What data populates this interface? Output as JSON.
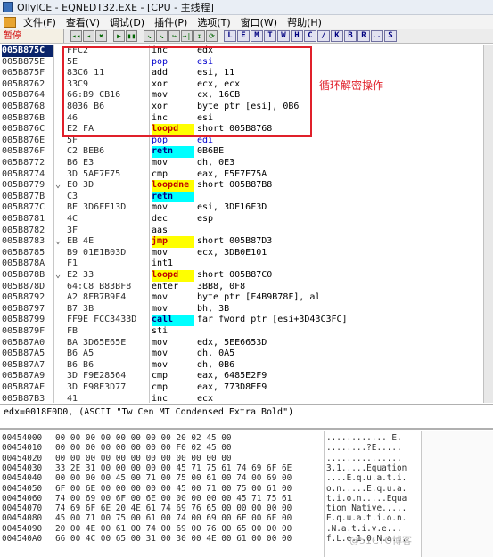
{
  "window": {
    "title": "OllyICE - EQNEDT32.EXE - [CPU - 主线程]"
  },
  "menu": {
    "items": [
      {
        "label": "文件(F)"
      },
      {
        "label": "查看(V)"
      },
      {
        "label": "调试(D)"
      },
      {
        "label": "插件(P)"
      },
      {
        "label": "选项(T)"
      },
      {
        "label": "窗口(W)"
      },
      {
        "label": "帮助(H)"
      }
    ]
  },
  "toolbar": {
    "status": "暂停",
    "controls": [
      "◂◂",
      "◂",
      "✖",
      "▶",
      "▮▮",
      "↘",
      "↘",
      "↪",
      "→|",
      "↧",
      "⟳",
      "..."
    ],
    "letters": [
      "L",
      "E",
      "M",
      "T",
      "W",
      "H",
      "C",
      "/",
      "K",
      "B",
      "R",
      "...",
      "S"
    ]
  },
  "disasm": {
    "annotation": "循环解密操作",
    "rows": [
      {
        "addr": "005B875C",
        "mark": "",
        "hex": "FFC2",
        "mnem": "inc",
        "ops": "edx",
        "style": ""
      },
      {
        "addr": "005B875E",
        "mark": "",
        "hex": "5E",
        "mnem": "pop",
        "ops": "esi",
        "style": "blu"
      },
      {
        "addr": "005B875F",
        "mark": "",
        "hex": "83C6 11",
        "mnem": "add",
        "ops": "esi, 11",
        "style": ""
      },
      {
        "addr": "005B8762",
        "mark": "",
        "hex": "33C9",
        "mnem": "xor",
        "ops": "ecx, ecx",
        "style": ""
      },
      {
        "addr": "005B8764",
        "mark": "",
        "hex": "66:B9 CB16",
        "mnem": "mov",
        "ops": "cx, 16CB",
        "style": ""
      },
      {
        "addr": "005B8768",
        "mark": "",
        "hex": "8036 B6",
        "mnem": "xor",
        "ops": "byte ptr [esi], 0B6",
        "style": ""
      },
      {
        "addr": "005B876B",
        "mark": "",
        "hex": "46",
        "mnem": "inc",
        "ops": "esi",
        "style": ""
      },
      {
        "addr": "005B876C",
        "mark": "",
        "hex": "E2 FA",
        "mnem": "loopd",
        "ops": "short 005B8768",
        "style": "hl"
      },
      {
        "addr": "005B876E",
        "mark": "",
        "hex": "5F",
        "mnem": "pop",
        "ops": "edi",
        "style": "blu"
      },
      {
        "addr": "005B876F",
        "mark": "",
        "hex": "C2 BEB6",
        "mnem": "retn",
        "ops": "0B6BE",
        "style": "hlc"
      },
      {
        "addr": "005B8772",
        "mark": "",
        "hex": "B6 E3",
        "mnem": "mov",
        "ops": "dh, 0E3",
        "style": ""
      },
      {
        "addr": "005B8774",
        "mark": "",
        "hex": "3D 5AE7E75",
        "mnem": "cmp",
        "ops": "eax, E5E7E75A",
        "style": ""
      },
      {
        "addr": "005B8779",
        "mark": "⌄",
        "hex": "E0 3D",
        "mnem": "loopdne",
        "ops": "short 005B87B8",
        "style": "hl"
      },
      {
        "addr": "005B877B",
        "mark": "",
        "hex": "C3",
        "mnem": "retn",
        "ops": "",
        "style": "hlc"
      },
      {
        "addr": "005B877C",
        "mark": "",
        "hex": "BE 3D6FE13D",
        "mnem": "mov",
        "ops": "esi, 3DE16F3D",
        "style": ""
      },
      {
        "addr": "005B8781",
        "mark": "",
        "hex": "4C",
        "mnem": "dec",
        "ops": "esp",
        "style": ""
      },
      {
        "addr": "005B8782",
        "mark": "",
        "hex": "3F",
        "mnem": "aas",
        "ops": "",
        "style": ""
      },
      {
        "addr": "005B8783",
        "mark": "⌄",
        "hex": "EB 4E",
        "mnem": "jmp",
        "ops": "short 005B87D3",
        "style": "hl"
      },
      {
        "addr": "005B8785",
        "mark": "",
        "hex": "B9 01E1B03D",
        "mnem": "mov",
        "ops": "ecx, 3DB0E101",
        "style": ""
      },
      {
        "addr": "005B878A",
        "mark": "",
        "hex": "F1",
        "mnem": "int1",
        "ops": "",
        "style": ""
      },
      {
        "addr": "005B878B",
        "mark": "⌄",
        "hex": "E2 33",
        "mnem": "loopd",
        "ops": "short 005B87C0",
        "style": "hl"
      },
      {
        "addr": "005B878D",
        "mark": "",
        "hex": "64:C8 B83BF8",
        "mnem": "enter",
        "ops": "3BB8, 0F8",
        "style": ""
      },
      {
        "addr": "005B8792",
        "mark": "",
        "hex": "A2 8FB7B9F4",
        "mnem": "mov",
        "ops": "byte ptr [F4B9B78F], al",
        "style": ""
      },
      {
        "addr": "005B8797",
        "mark": "",
        "hex": "B7 3B",
        "mnem": "mov",
        "ops": "bh, 3B",
        "style": ""
      },
      {
        "addr": "005B8799",
        "mark": "",
        "hex": "FF9E FCC3433D",
        "mnem": "call",
        "ops": "far fword ptr [esi+3D43C3FC]",
        "style": "hlc"
      },
      {
        "addr": "005B879F",
        "mark": "",
        "hex": "FB",
        "mnem": "sti",
        "ops": "",
        "style": ""
      },
      {
        "addr": "005B87A0",
        "mark": "",
        "hex": "BA 3D65E65E",
        "mnem": "mov",
        "ops": "edx, 5EE6653D",
        "style": ""
      },
      {
        "addr": "005B87A5",
        "mark": "",
        "hex": "B6 A5",
        "mnem": "mov",
        "ops": "dh, 0A5",
        "style": ""
      },
      {
        "addr": "005B87A7",
        "mark": "",
        "hex": "B6 B6",
        "mnem": "mov",
        "ops": "dh, 0B6",
        "style": ""
      },
      {
        "addr": "005B87A9",
        "mark": "",
        "hex": "3D F9E28564",
        "mnem": "cmp",
        "ops": "eax, 6485E2F9",
        "style": ""
      },
      {
        "addr": "005B87AE",
        "mark": "",
        "hex": "3D E98E3D77",
        "mnem": "cmp",
        "ops": "eax, 773D8EE9",
        "style": ""
      },
      {
        "addr": "005B87B3",
        "mark": "",
        "hex": "41",
        "mnem": "inc",
        "ops": "ecx",
        "style": ""
      }
    ]
  },
  "info": {
    "text": "edx=0018F0D0, (ASCII \"Tw Cen MT Condensed Extra Bold\")"
  },
  "dump": {
    "rows": [
      {
        "addr": "00454000",
        "hex": "00 00 00 00 00 00 00 00 20 02 45 00",
        "ascii": "............ E."
      },
      {
        "addr": "00454010",
        "hex": "00 00 00 00 00 00 00 00 F0 02 45 00",
        "ascii": "........?E....."
      },
      {
        "addr": "00454020",
        "hex": "00 00 00 00 00 00 00 00 00 00 00 00",
        "ascii": "..............."
      },
      {
        "addr": "00454030",
        "hex": "33 2E 31 00 00 00 00 00 45 71 75 61 74 69 6F 6E",
        "ascii": "3.1.....Equation"
      },
      {
        "addr": "00454040",
        "hex": "00 00 00 00 45 00 71 00 75 00 61 00 74 00 69 00",
        "ascii": "....E.q.u.a.t.i."
      },
      {
        "addr": "00454050",
        "hex": "6F 00 6E 00 00 00 00 00 45 00 71 00 75 00 61 00",
        "ascii": "o.n.....E.q.u.a."
      },
      {
        "addr": "00454060",
        "hex": "74 00 69 00 6F 00 6E 00 00 00 00 00 45 71 75 61",
        "ascii": "t.i.o.n.....Equa"
      },
      {
        "addr": "00454070",
        "hex": "74 69 6F 6E 20 4E 61 74 69 76 65 00 00 00 00 00",
        "ascii": "tion Native....."
      },
      {
        "addr": "00454080",
        "hex": "45 00 71 00 75 00 61 00 74 00 69 00 6F 00 6E 00",
        "ascii": "E.q.u.a.t.i.o.n."
      },
      {
        "addr": "00454090",
        "hex": "20 00 4E 00 61 00 74 00 69 00 76 00 65 00 00 00",
        "ascii": " .N.a.t.i.v.e..."
      },
      {
        "addr": "004540A0",
        "hex": "66 00 4C 00 65 00 31 00 30 00 4E 00 61 00 00 00",
        "ascii": "f.L.e.1.0.N.a..."
      }
    ]
  },
  "watermark": {
    "text": "@51CTO博客"
  },
  "colors": {
    "annotation": "#e0202a",
    "highlight_jump": "#ffff00",
    "highlight_call": "#00ffff",
    "selection": "#0a246a"
  }
}
